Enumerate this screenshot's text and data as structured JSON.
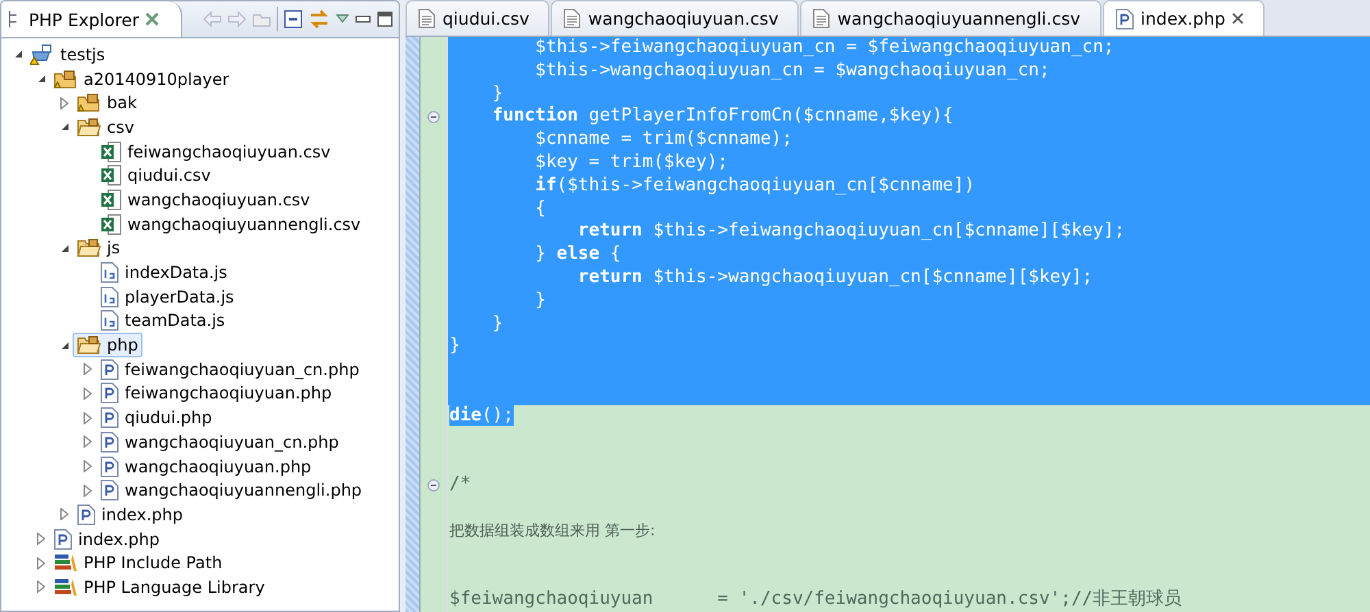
{
  "explorer": {
    "title": "PHP Explorer",
    "tree": [
      {
        "label": "testjs",
        "kind": "project",
        "expanded": true,
        "selected": false,
        "children": [
          {
            "label": "a20140910player",
            "kind": "package",
            "expanded": true,
            "selected": false,
            "children": [
              {
                "label": "bak",
                "kind": "package",
                "expanded": false,
                "selected": false
              },
              {
                "label": "csv",
                "kind": "folder",
                "expanded": true,
                "selected": false,
                "children": [
                  {
                    "label": "feiwangchaoqiuyuan.csv",
                    "kind": "csv",
                    "selected": false
                  },
                  {
                    "label": "qiudui.csv",
                    "kind": "csv",
                    "selected": false
                  },
                  {
                    "label": "wangchaoqiuyuan.csv",
                    "kind": "csv",
                    "selected": false
                  },
                  {
                    "label": "wangchaoqiuyuannengli.csv",
                    "kind": "csv",
                    "selected": false
                  }
                ]
              },
              {
                "label": "js",
                "kind": "folder",
                "expanded": true,
                "selected": false,
                "children": [
                  {
                    "label": "indexData.js",
                    "kind": "js",
                    "selected": false
                  },
                  {
                    "label": "playerData.js",
                    "kind": "js",
                    "selected": false
                  },
                  {
                    "label": "teamData.js",
                    "kind": "js",
                    "selected": false
                  }
                ]
              },
              {
                "label": "php",
                "kind": "folder",
                "expanded": true,
                "selected": true,
                "children": [
                  {
                    "label": "feiwangchaoqiuyuan_cn.php",
                    "kind": "php",
                    "expanded": false,
                    "selected": false
                  },
                  {
                    "label": "feiwangchaoqiuyuan.php",
                    "kind": "php",
                    "expanded": false,
                    "selected": false
                  },
                  {
                    "label": "qiudui.php",
                    "kind": "php",
                    "expanded": false,
                    "selected": false
                  },
                  {
                    "label": "wangchaoqiuyuan_cn.php",
                    "kind": "php",
                    "expanded": false,
                    "selected": false
                  },
                  {
                    "label": "wangchaoqiuyuan.php",
                    "kind": "php",
                    "expanded": false,
                    "selected": false
                  },
                  {
                    "label": "wangchaoqiuyuannengli.php",
                    "kind": "php",
                    "expanded": false,
                    "selected": false
                  }
                ]
              },
              {
                "label": "index.php",
                "kind": "php",
                "expanded": false,
                "selected": false
              }
            ]
          },
          {
            "label": "index.php",
            "kind": "php",
            "expanded": false,
            "selected": false
          },
          {
            "label": "PHP Include Path",
            "kind": "library",
            "expanded": false,
            "selected": false
          },
          {
            "label": "PHP Language Library",
            "kind": "library",
            "expanded": false,
            "selected": false
          }
        ]
      }
    ]
  },
  "editor": {
    "tabs": [
      {
        "label": "qiudui.csv",
        "kind": "text",
        "selected": false
      },
      {
        "label": "wangchaoqiuyuan.csv",
        "kind": "text",
        "selected": false
      },
      {
        "label": "wangchaoqiuyuannengli.csv",
        "kind": "text",
        "selected": false
      },
      {
        "label": "index.php",
        "kind": "php",
        "selected": true
      }
    ],
    "lines": [
      {
        "text": "        $this->feiwangchaoqiuyuan_cn = $feiwangchaoqiuyuan_cn;",
        "selected": true,
        "foldable": false
      },
      {
        "text": "        $this->wangchaoqiuyuan_cn = $wangchaoqiuyuan_cn;",
        "selected": true,
        "foldable": false
      },
      {
        "text": "    }",
        "selected": true,
        "foldable": false
      },
      {
        "text": "    **function** getPlayerInfoFromCn($cnname,$key){",
        "selected": true,
        "foldable": true
      },
      {
        "text": "        $cnname = trim($cnname);",
        "selected": true,
        "foldable": false
      },
      {
        "text": "        $key = trim($key);",
        "selected": true,
        "foldable": false
      },
      {
        "text": "        **if**($this->feiwangchaoqiuyuan_cn[$cnname])",
        "selected": true,
        "foldable": false
      },
      {
        "text": "        {",
        "selected": true,
        "foldable": false
      },
      {
        "text": "            **return** $this->feiwangchaoqiuyuan_cn[$cnname][$key];",
        "selected": true,
        "foldable": false
      },
      {
        "text": "        } **else** {",
        "selected": true,
        "foldable": false
      },
      {
        "text": "            **return** $this->wangchaoqiuyuan_cn[$cnname][$key];",
        "selected": true,
        "foldable": false
      },
      {
        "text": "        }",
        "selected": true,
        "foldable": false
      },
      {
        "text": "    }",
        "selected": true,
        "foldable": false
      },
      {
        "text": "}",
        "selected": true,
        "foldable": false
      },
      {
        "selected": true,
        "foldable": false
      },
      {
        "selected": true,
        "foldable": false
      },
      {
        "text": "**die**();",
        "selected": true,
        "foldable": false
      },
      {
        "selected": false,
        "foldable": false
      },
      {
        "selected": false,
        "foldable": false
      },
      {
        "text": "/*",
        "selected": false,
        "foldable": true
      },
      {
        "selected": false,
        "foldable": false
      },
      {
        "text": "把数据组装成数组来用 第一步:",
        "selected": false,
        "foldable": false,
        "kind": "prose"
      },
      {
        "selected": false,
        "foldable": false
      },
      {
        "selected": false,
        "foldable": false
      },
      {
        "text": "$feiwangchaoqiuyuan      = './csv/feiwangchaoqiuyuan.csv';//非王朝球员",
        "selected": false,
        "foldable": false
      }
    ]
  }
}
